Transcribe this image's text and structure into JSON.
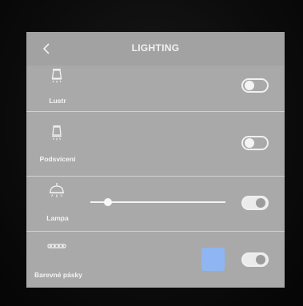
{
  "header": {
    "title": "LIGHTING",
    "back_icon": "chevron-left-icon"
  },
  "rows": [
    {
      "label": "Lustr",
      "icon": "chandelier-icon",
      "toggle_on": false
    },
    {
      "label": "Podsvícení",
      "icon": "backlight-lamp-icon",
      "toggle_on": false
    },
    {
      "label": "Lampa",
      "icon": "pendant-lamp-icon",
      "toggle_on": true,
      "dimmer_level": 0.13
    },
    {
      "label": "Barevné pásky",
      "icon": "led-strip-icon",
      "toggle_on": true,
      "color": "#8fb6f2"
    }
  ],
  "colors": {
    "screen": "#a8a8a8",
    "text": "#f4f4f4",
    "swatch": "#8fb6f2"
  }
}
